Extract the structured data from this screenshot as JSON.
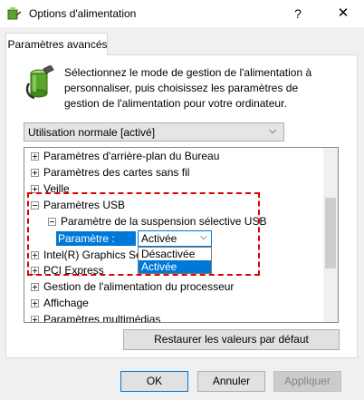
{
  "window": {
    "title": "Options d'alimentation",
    "help_glyph": "?",
    "close_glyph": "✕"
  },
  "tab": {
    "label": "Paramètres avancés"
  },
  "description": "Sélectionnez le mode de gestion de l'alimentation à personnaliser, puis choisissez les paramètres de gestion de l'alimentation pour votre ordinateur.",
  "plan_select": {
    "value": "Utilisation normale [activé]",
    "chevron": "⌵"
  },
  "tree": {
    "items": [
      {
        "label": "Paramètres d'arrière-plan du Bureau",
        "state": "collapsed"
      },
      {
        "label": "Paramètres des cartes sans fil",
        "state": "collapsed"
      },
      {
        "label": "Veille",
        "state": "collapsed"
      },
      {
        "label": "Paramètres USB",
        "state": "expanded"
      },
      {
        "label": "Paramètre de la suspension sélective USB",
        "state": "expanded"
      },
      {
        "label": "Intel(R) Graphics Se",
        "state": "collapsed"
      },
      {
        "label": "PCI Express",
        "state": "collapsed"
      },
      {
        "label": "Gestion de l'alimentation du processeur",
        "state": "collapsed"
      },
      {
        "label": "Affichage",
        "state": "collapsed"
      },
      {
        "label": "Paramètres multimédias",
        "state": "collapsed"
      }
    ]
  },
  "setting": {
    "label": "Paramètre :",
    "current_value": "Activée",
    "chevron": "⌵",
    "options": [
      "Désactivée",
      "Activée"
    ],
    "selected_option": "Activée"
  },
  "buttons": {
    "restore": "Restaurer les valeurs par défaut",
    "ok": "OK",
    "cancel": "Annuler",
    "apply": "Appliquer"
  },
  "colors": {
    "accent": "#0078d7",
    "highlight": "#e00000",
    "dialog_bg": "#f0f0f0"
  },
  "icons": [
    "power-options-icon",
    "battery-plug-icon",
    "help-icon",
    "close-icon",
    "chevron-down-icon",
    "expand-icon",
    "collapse-icon"
  ]
}
